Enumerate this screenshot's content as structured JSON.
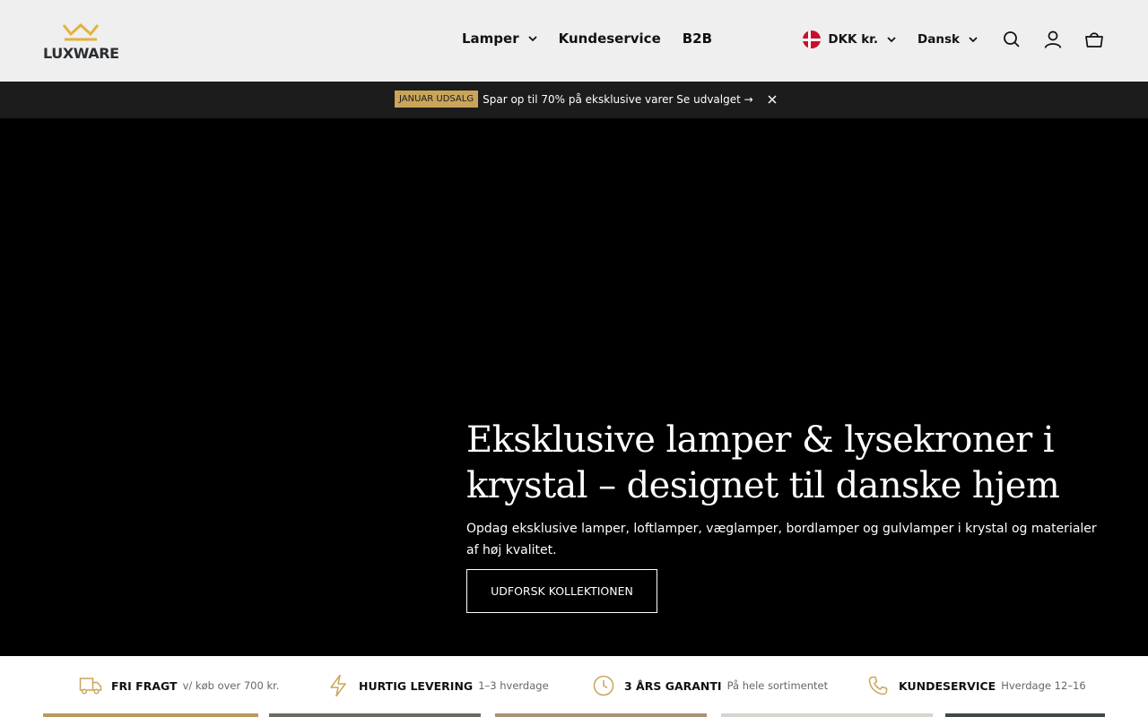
{
  "brand": {
    "logo_text": "LUXWARE",
    "accent_color": "#c9a55a"
  },
  "nav": {
    "items": [
      {
        "label": "Lamper",
        "has_dropdown": true
      },
      {
        "label": "Kundeservice",
        "has_dropdown": false
      },
      {
        "label": "B2B",
        "has_dropdown": false
      }
    ]
  },
  "tools": {
    "currency": "DKK kr.",
    "language": "Dansk",
    "icons": [
      "search-icon",
      "account-icon",
      "cart-icon"
    ]
  },
  "announcement": {
    "badge": "JANUAR UDSALG",
    "text": "Spar op til 70% på eksklusive varer Se udvalget →"
  },
  "hero": {
    "title": "Eksklusive lamper & lysekroner i krystal – designet til danske hjem",
    "subtitle": "Opdag eksklusive lamper, loftlamper, væglamper, bordlamper og gulvlamper i krystal og materialer af høj kvalitet.",
    "button": "UDFORSK KOLLEKTIONEN"
  },
  "usp": [
    {
      "icon": "truck-icon",
      "title": "FRI FRAGT",
      "sub": "v/ køb over 700 kr."
    },
    {
      "icon": "lightning-icon",
      "title": "HURTIG LEVERING",
      "sub": "1–3 hverdage"
    },
    {
      "icon": "clock-icon",
      "title": "3 ÅRS GARANTI",
      "sub": "På hele sortimentet"
    },
    {
      "icon": "phone-icon",
      "title": "KUNDESERVICE",
      "sub": "Hverdage 12–16"
    }
  ]
}
